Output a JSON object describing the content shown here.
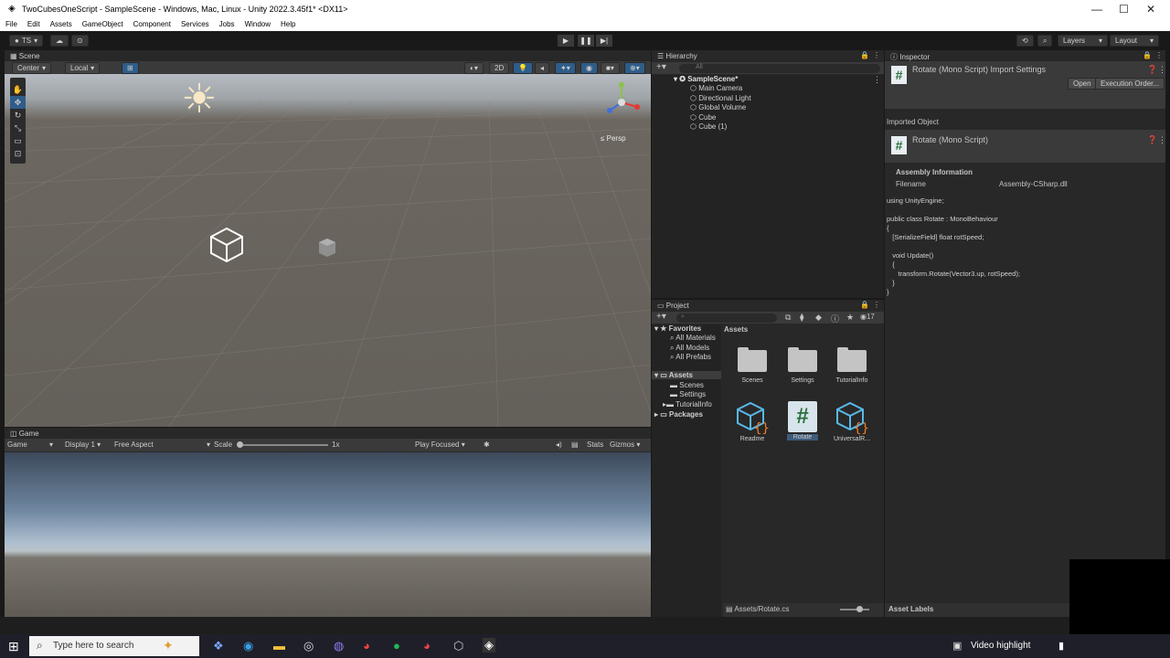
{
  "window": {
    "title": "TwoCubesOneScript - SampleScene - Windows, Mac, Linux - Unity 2022.3.45f1* <DX11>"
  },
  "menu": [
    "File",
    "Edit",
    "Assets",
    "GameObject",
    "Component",
    "Services",
    "Jobs",
    "Window",
    "Help"
  ],
  "toolbar": {
    "account": "TS",
    "layers": "Layers",
    "layout": "Layout"
  },
  "scene": {
    "tab": "Scene",
    "pivot": "Center",
    "space": "Local",
    "mode2d": "2D",
    "persp": "Persp"
  },
  "game": {
    "tab": "Game",
    "view": "Game",
    "display": "Display 1",
    "aspect": "Free Aspect",
    "scale_label": "Scale",
    "scale_value": "1x",
    "play_focused": "Play Focused",
    "stats": "Stats",
    "gizmos": "Gizmos"
  },
  "hierarchy": {
    "tab": "Hierarchy",
    "search_placeholder": "All",
    "scene": "SampleScene*",
    "items": [
      "Main Camera",
      "Directional Light",
      "Global Volume",
      "Cube",
      "Cube (1)"
    ]
  },
  "project": {
    "tab": "Project",
    "count": "17",
    "favorites": "Favorites",
    "fav_items": [
      "All Materials",
      "All Models",
      "All Prefabs"
    ],
    "assets_root": "Assets",
    "asset_folders": [
      "Scenes",
      "Settings",
      "TutorialInfo"
    ],
    "packages": "Packages",
    "breadcrumb": "Assets",
    "assets": [
      "Scenes",
      "Settings",
      "TutorialInfo",
      "Readme",
      "Rotate",
      "UniversalR..."
    ],
    "footer_path": "Assets/Rotate.cs"
  },
  "inspector": {
    "tab": "Inspector",
    "title": "Rotate (Mono Script) Import Settings",
    "open": "Open",
    "exec_order": "Execution Order...",
    "imported_object": "Imported Object",
    "obj_title": "Rotate (Mono Script)",
    "assembly_header": "Assembly Information",
    "filename_label": "Filename",
    "filename_value": "Assembly-CSharp.dll",
    "code": [
      "using UnityEngine;",
      "",
      "public class Rotate : MonoBehaviour",
      "{",
      "   [SerializeField] float rotSpeed;",
      "",
      "   void Update()",
      "   {",
      "      transform.Rotate(Vector3.up, rotSpeed);",
      "   }",
      "}"
    ],
    "asset_labels": "Asset Labels"
  },
  "taskbar": {
    "search_placeholder": "Type here to search",
    "video_highlight": "Video highlight"
  }
}
